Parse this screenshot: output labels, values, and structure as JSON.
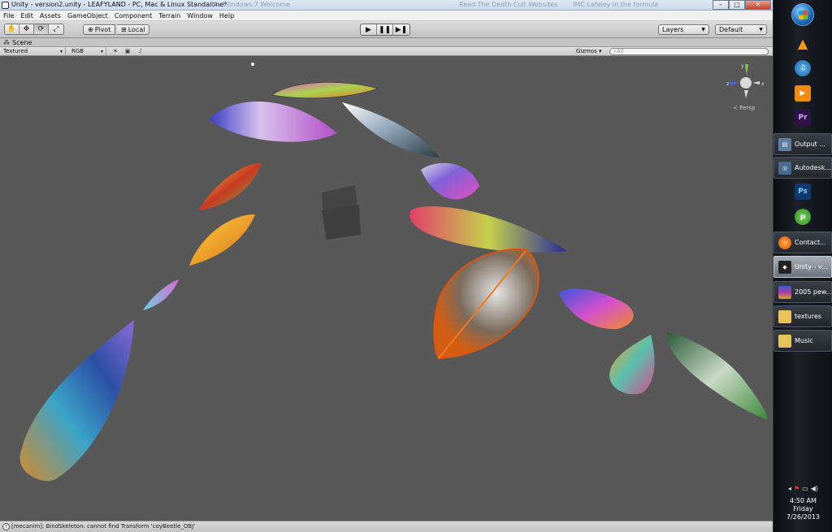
{
  "window": {
    "title": "Unity - version2.unity - LEAFYLAND - PC, Mac & Linux Standalone*",
    "ghost_tabs": [
      "Read The Death Cult Websites",
      "IMC Lafeley in the formula",
      "Mr. Windows 7 Welcome"
    ],
    "minimize": "–",
    "maximize": "□",
    "close": "✕"
  },
  "menu": [
    "File",
    "Edit",
    "Assets",
    "GameObject",
    "Component",
    "Terrain",
    "Window",
    "Help"
  ],
  "toolbar": {
    "tools": [
      {
        "name": "hand-tool",
        "glyph": "✋"
      },
      {
        "name": "move-tool",
        "glyph": "✥"
      },
      {
        "name": "rotate-tool",
        "glyph": "⟳"
      },
      {
        "name": "scale-tool",
        "glyph": "⤢"
      }
    ],
    "pivot_label": "Pivot",
    "local_label": "Local",
    "play": "▶",
    "pause": "❚❚",
    "step": "▶❚",
    "layers_label": "Layers",
    "layout_label": "Default"
  },
  "scene": {
    "tab_label": "Scene",
    "render_mode": "Textured",
    "color_mode": "RGB",
    "gizmos_label": "Gizmos",
    "search_placeholder": "All",
    "persp_label": "Persp",
    "axis_x": "x",
    "axis_y": "y",
    "axis_z": "z"
  },
  "status": {
    "message": "[mecanim]: BindSkeleton: cannot find Transform 'coyBeetle_OBJ'"
  },
  "taskbar": {
    "pinned": [
      {
        "name": "vlc-icon",
        "color": "#f08c00",
        "glyph": "▲"
      },
      {
        "name": "itunes-icon",
        "color": "#2a8fd8",
        "glyph": "♫"
      },
      {
        "name": "media-player-icon",
        "color": "#f07d16",
        "glyph": "▶"
      },
      {
        "name": "premiere-icon",
        "color": "#3b1f5e",
        "glyph": "Pr"
      }
    ],
    "windows": [
      {
        "label": "Output ...",
        "name": "task-output",
        "color": "#5d7da3",
        "glyph": "▤"
      },
      {
        "label": "Autodesk...",
        "name": "task-autodesk",
        "color": "#486a8e",
        "glyph": "◎"
      }
    ],
    "mid_pins": [
      {
        "name": "photoshop-icon",
        "color": "#1b4e8e",
        "glyph": "Ps"
      },
      {
        "name": "utorrent-icon",
        "color": "#37a93a",
        "glyph": "µ"
      }
    ],
    "windows2": [
      {
        "label": "Contact...",
        "name": "task-firefox",
        "color": "#e36a1b",
        "glyph": "●",
        "active": false
      },
      {
        "label": "Unity - v...",
        "name": "task-unity",
        "color": "#2b2b2b",
        "glyph": "◆",
        "active": true
      },
      {
        "label": "2005 pew...",
        "name": "task-winrar",
        "color": "#7b3a8f",
        "glyph": "▦",
        "active": false
      },
      {
        "label": "textures",
        "name": "task-textures-folder",
        "color": "#e8c35a",
        "glyph": "▬",
        "active": false
      },
      {
        "label": "Music",
        "name": "task-music-folder",
        "color": "#e8c35a",
        "glyph": "▬",
        "active": false
      }
    ],
    "time": "4:50 AM",
    "day": "Friday",
    "date": "7/26/2013"
  }
}
